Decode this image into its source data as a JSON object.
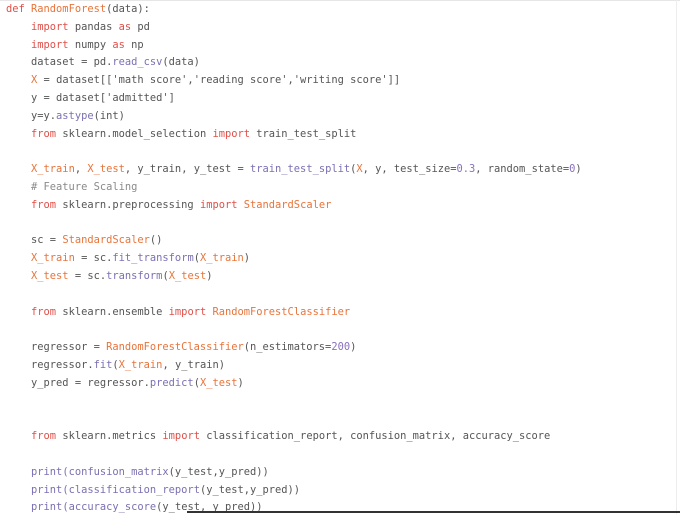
{
  "colors": {
    "keyword": "#e0504a",
    "identifier": "#e8743b",
    "function": "#7b70b3",
    "text": "#555555",
    "comment": "#8a8a8a"
  },
  "code_lines": [
    [
      [
        "def ",
        "kw"
      ],
      [
        "RandomForest",
        "id"
      ],
      [
        "(data):",
        "tx"
      ]
    ],
    [
      [
        "    ",
        "tx"
      ],
      [
        "import",
        "kw"
      ],
      [
        " pandas ",
        "tx"
      ],
      [
        "as",
        "kw"
      ],
      [
        " pd",
        "tx"
      ]
    ],
    [
      [
        "    ",
        "tx"
      ],
      [
        "import",
        "kw"
      ],
      [
        " numpy ",
        "tx"
      ],
      [
        "as",
        "kw"
      ],
      [
        " np",
        "tx"
      ]
    ],
    [
      [
        "    dataset = pd.",
        "tx"
      ],
      [
        "read_csv",
        "fn"
      ],
      [
        "(data)",
        "tx"
      ]
    ],
    [
      [
        "    ",
        "tx"
      ],
      [
        "X",
        "id"
      ],
      [
        " = dataset[['math score','reading score','writing score']]",
        "tx"
      ]
    ],
    [
      [
        "    y = dataset['admitted']",
        "tx"
      ]
    ],
    [
      [
        "    y=y.",
        "tx"
      ],
      [
        "astype",
        "fn"
      ],
      [
        "(int)",
        "tx"
      ]
    ],
    [
      [
        "    ",
        "tx"
      ],
      [
        "from",
        "kw"
      ],
      [
        " sklearn.model_selection ",
        "tx"
      ],
      [
        "import",
        "kw"
      ],
      [
        " train_test_split",
        "tx"
      ]
    ],
    [],
    [
      [
        "    ",
        "tx"
      ],
      [
        "X_train",
        "id"
      ],
      [
        ", ",
        "tx"
      ],
      [
        "X_test",
        "id"
      ],
      [
        ", y_train, y_test = ",
        "tx"
      ],
      [
        "train_test_split",
        "fn"
      ],
      [
        "(",
        "tx"
      ],
      [
        "X",
        "id"
      ],
      [
        ", y, test_size=",
        "tx"
      ],
      [
        "0.3",
        "num"
      ],
      [
        ", random_state=",
        "tx"
      ],
      [
        "0",
        "num"
      ],
      [
        ")",
        "tx"
      ]
    ],
    [
      [
        "    # Feature Scaling",
        "cm"
      ]
    ],
    [
      [
        "    ",
        "tx"
      ],
      [
        "from",
        "kw"
      ],
      [
        " sklearn.preprocessing ",
        "tx"
      ],
      [
        "import",
        "kw"
      ],
      [
        " ",
        "tx"
      ],
      [
        "StandardScaler",
        "id"
      ]
    ],
    [],
    [
      [
        "    sc = ",
        "tx"
      ],
      [
        "StandardScaler",
        "id"
      ],
      [
        "()",
        "tx"
      ]
    ],
    [
      [
        "    ",
        "tx"
      ],
      [
        "X_train",
        "id"
      ],
      [
        " = sc.",
        "tx"
      ],
      [
        "fit_transform",
        "fn"
      ],
      [
        "(",
        "tx"
      ],
      [
        "X_train",
        "id"
      ],
      [
        ")",
        "tx"
      ]
    ],
    [
      [
        "    ",
        "tx"
      ],
      [
        "X_test",
        "id"
      ],
      [
        " = sc.",
        "tx"
      ],
      [
        "transform",
        "fn"
      ],
      [
        "(",
        "tx"
      ],
      [
        "X_test",
        "id"
      ],
      [
        ")",
        "tx"
      ]
    ],
    [],
    [
      [
        "    ",
        "tx"
      ],
      [
        "from",
        "kw"
      ],
      [
        " sklearn.ensemble ",
        "tx"
      ],
      [
        "import",
        "kw"
      ],
      [
        " ",
        "tx"
      ],
      [
        "RandomForestClassifier",
        "id"
      ]
    ],
    [],
    [
      [
        "    regressor = ",
        "tx"
      ],
      [
        "RandomForestClassifier",
        "id"
      ],
      [
        "(n_estimators=",
        "tx"
      ],
      [
        "200",
        "num"
      ],
      [
        ")",
        "tx"
      ]
    ],
    [
      [
        "    regressor.",
        "tx"
      ],
      [
        "fit",
        "fn"
      ],
      [
        "(",
        "tx"
      ],
      [
        "X_train",
        "id"
      ],
      [
        ", y_train)",
        "tx"
      ]
    ],
    [
      [
        "    y_pred = regressor.",
        "tx"
      ],
      [
        "predict",
        "fn"
      ],
      [
        "(",
        "tx"
      ],
      [
        "X_test",
        "id"
      ],
      [
        ")",
        "tx"
      ]
    ],
    [],
    [],
    [
      [
        "    ",
        "tx"
      ],
      [
        "from",
        "kw"
      ],
      [
        " sklearn.metrics ",
        "tx"
      ],
      [
        "import",
        "kw"
      ],
      [
        " classification_report, confusion_matrix, accuracy_score",
        "tx"
      ]
    ],
    [],
    [
      [
        "    ",
        "tx"
      ],
      [
        "print",
        "fn"
      ],
      [
        "(",
        "fn"
      ],
      [
        "confusion_matrix",
        "fn"
      ],
      [
        "(y_test,y_pred))",
        "tx"
      ]
    ],
    [
      [
        "    ",
        "tx"
      ],
      [
        "print",
        "fn"
      ],
      [
        "(",
        "fn"
      ],
      [
        "classification_report",
        "fn"
      ],
      [
        "(y_test,y_pred))",
        "tx"
      ]
    ],
    [
      [
        "    ",
        "tx"
      ],
      [
        "print",
        "fn"
      ],
      [
        "(",
        "fn"
      ],
      [
        "accuracy_score",
        "fn"
      ],
      [
        "(y_test, y_pred))",
        "tx"
      ]
    ]
  ]
}
